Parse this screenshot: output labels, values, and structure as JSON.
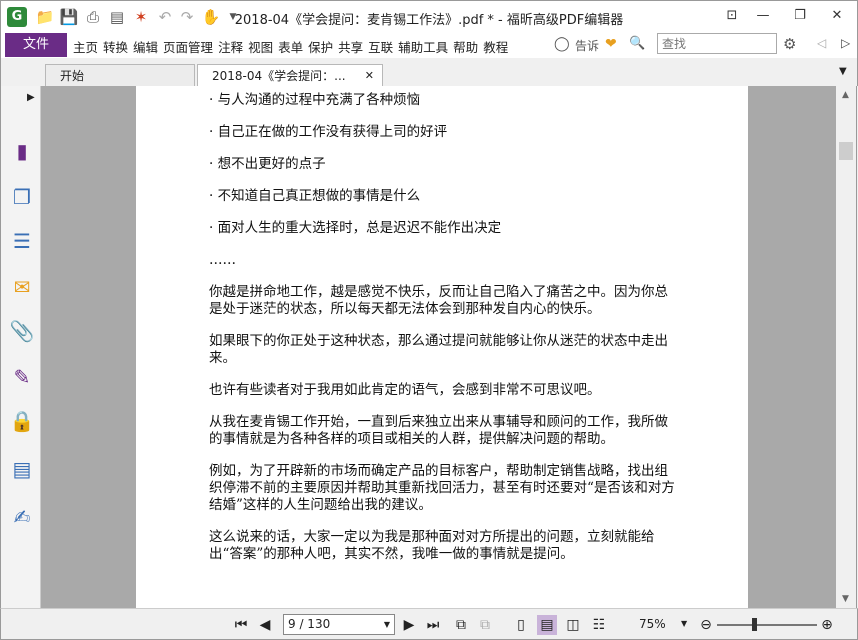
{
  "window": {
    "title": "2018-04《学会提问：麦肯锡工作法》.pdf * - 福昕高级PDF编辑器",
    "app_icon": "G",
    "minimize_icon": "—",
    "restore_icon": "❐",
    "close_icon": "✕",
    "ribbon_toggle_icon": "⊡"
  },
  "menu": {
    "file": "文件",
    "items": [
      "主页",
      "转换",
      "编辑",
      "页面管理",
      "注释",
      "视图",
      "表单",
      "保护",
      "共享",
      "互联",
      "辅助工具",
      "帮助",
      "教程"
    ],
    "tell_me": "告诉",
    "search_placeholder": "查找"
  },
  "tabs": {
    "start": "开始",
    "doc": "2018-04《学会提问：...",
    "close": "✕"
  },
  "document": {
    "paragraphs": [
      "· 与人沟通的过程中充满了各种烦恼",
      "· 自己正在做的工作没有获得上司的好评",
      "· 想不出更好的点子",
      "· 不知道自己真正想做的事情是什么",
      "· 面对人生的重大选择时，总是迟迟不能作出决定",
      "……",
      "你越是拼命地工作，越是感觉不快乐，反而让自己陷入了痛苦之中。因为你总是处于迷茫的状态，所以每天都无法体会到那种发自内心的快乐。",
      "如果眼下的你正处于这种状态，那么通过提问就能够让你从迷茫的状态中走出来。",
      "也许有些读者对于我用如此肯定的语气，会感到非常不可思议吧。",
      "从我在麦肯锡工作开始，一直到后来独立出来从事辅导和顾问的工作，我所做的事情就是为各种各样的项目或相关的人群，提供解决问题的帮助。",
      "例如，为了开辟新的市场而确定产品的目标客户，帮助制定销售战略，找出组织停滞不前的主要原因并帮助其重新找回活力，甚至有时还要对“是否该和对方结婚”这样的人生问题给出我的建议。",
      "这么说来的话，大家一定以为我是那种面对对方所提出的问题，立刻就能给出“答案”的那种人吧，其实不然，我唯一做的事情就是提问。"
    ]
  },
  "status": {
    "page_display": "9 / 130",
    "zoom": "75%"
  },
  "colors": {
    "file_menu": "#6a2c86",
    "viewer_bg": "#a9a9a9",
    "page_bg": "#ffffff"
  }
}
